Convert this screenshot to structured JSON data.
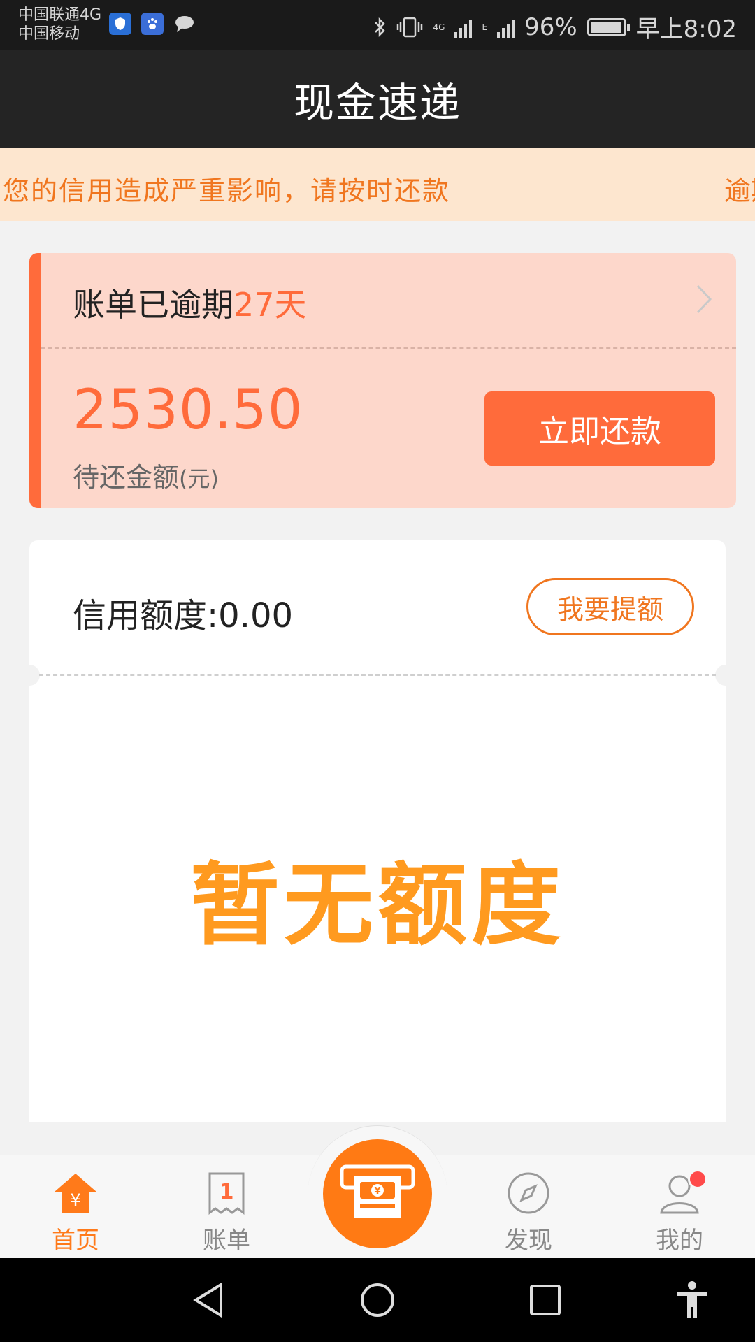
{
  "status_bar": {
    "carrier_1": "中国联通4G",
    "carrier_2": "中国移动",
    "network_1": "4G",
    "network_2": "E",
    "battery": "96%",
    "time": "早上8:02",
    "icons": [
      "shield-app-icon",
      "baidu-app-icon",
      "message-icon",
      "bluetooth-icon",
      "vibrate-icon",
      "signal-icon",
      "signal-icon",
      "battery-icon"
    ]
  },
  "header": {
    "title": "现金速递"
  },
  "notice": {
    "text": "您的信用造成严重影响，请按时还款",
    "text_next": "逾期"
  },
  "overdue": {
    "prefix": "账单已逾期",
    "days": "27天",
    "amount": "2530.50",
    "amount_label": "待还金额",
    "amount_unit": "(元)",
    "pay_button": "立即还款"
  },
  "credit": {
    "label": "信用额度:0.00",
    "raise_button": "我要提额",
    "empty_text": "暂无额度"
  },
  "tabs": [
    {
      "label": "首页",
      "icon": "home-yuan-icon",
      "active": true
    },
    {
      "label": "账单",
      "icon": "bill-icon",
      "active": false
    },
    {
      "label": "发现",
      "icon": "compass-icon",
      "active": false
    },
    {
      "label": "我的",
      "icon": "user-icon",
      "active": false
    }
  ],
  "center_action": {
    "icon": "cash-machine-icon"
  },
  "colors": {
    "accent": "#ff6b3b",
    "tab_active": "#ff7a1a",
    "empty_text": "#ff9a1f",
    "notice_bg": "#fde6cf",
    "overdue_bg": "#fdd7cb"
  }
}
